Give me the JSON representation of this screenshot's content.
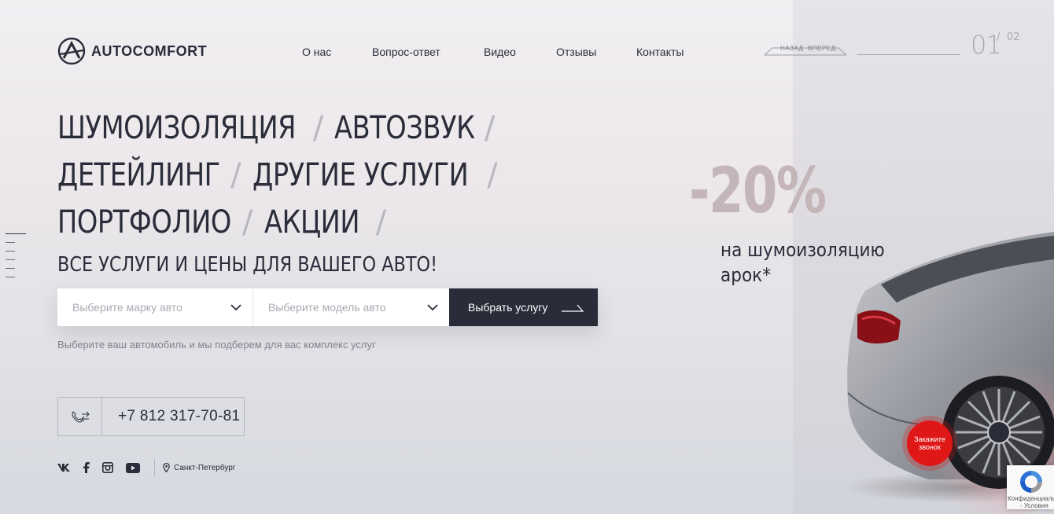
{
  "brand": {
    "name": "AUTOCOMFORT"
  },
  "nav": {
    "items": [
      "О нас",
      "Вопрос-ответ",
      "Видео",
      "Отзывы",
      "Контакты"
    ]
  },
  "slider": {
    "back_label": "НАЗАД",
    "forward_label": "ВПЕРЕД",
    "current": "01",
    "separator": "/",
    "total": "02"
  },
  "services": {
    "lines": [
      [
        "ШУМОИЗОЛЯЦИЯ",
        "АВТОЗВУК"
      ],
      [
        "ДЕТЕЙЛИНГ",
        "ДРУГИЕ УСЛУГИ"
      ],
      [
        "ПОРТФОЛИО",
        "АКЦИИ"
      ]
    ],
    "separator": "/"
  },
  "subheading": "ВСЕ УСЛУГИ И ЦЕНЫ ДЛЯ ВАШЕГО АВТО!",
  "selector": {
    "brand_placeholder": "Выберите марку авто",
    "model_placeholder": "Выберите модель авто",
    "submit_label": "Выбрать услугу",
    "hint": "Выберите ваш автомобиль и мы подберем для вас комплекс услуг"
  },
  "contact": {
    "phone": "+7 812 317-70-81",
    "city": "Санкт-Петербург"
  },
  "social": [
    "vk-icon",
    "facebook-icon",
    "instagram-icon",
    "youtube-icon"
  ],
  "promo": {
    "discount": "-20%",
    "line1": "на шумоизоляцию",
    "line2": "арок*"
  },
  "callback": {
    "line1": "Закажите",
    "line2": "звонок"
  },
  "recaptcha": {
    "text1": "Конфиденциальн",
    "text2": "- Условия"
  },
  "colors": {
    "primary": "#2a2c3a",
    "accent": "#e01717",
    "muted": "#a9aab2",
    "promo": "#c4b5b8"
  }
}
